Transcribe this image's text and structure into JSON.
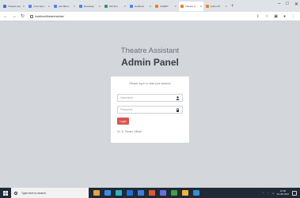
{
  "browser": {
    "tabs": [
      {
        "label": "Theatre Ass",
        "favicon_color": "#3b6fd6",
        "active": false
      },
      {
        "label": "(YouTube) -",
        "favicon_color": "#4a86e8",
        "active": false
      },
      {
        "label": "Ask Blind -",
        "favicon_color": "#4a86e8",
        "active": false
      },
      {
        "label": "Bootstrap",
        "favicon_color": "#4a86e8",
        "active": false
      },
      {
        "label": "W3 Sch",
        "favicon_color": "#2e9b4f",
        "active": false
      },
      {
        "label": "localhost",
        "favicon_color": "#4a86e8",
        "active": false
      },
      {
        "label": "XAMPP",
        "favicon_color": "#f07d20",
        "active": false
      },
      {
        "label": "Theatre A",
        "favicon_color": "#f07d20",
        "active": true
      },
      {
        "label": "Admin Pl",
        "favicon_color": "#f07d20",
        "active": false
      }
    ],
    "new_tab": "+",
    "window_controls": {
      "minimize": "–",
      "maximize": "□",
      "close": "✕"
    },
    "address": "localhost/theatre/admin/"
  },
  "page": {
    "heading": "Theatre Assistant",
    "subheading": "Admin Panel",
    "card": {
      "message": "Please log in to start your session",
      "username_placeholder": "Username",
      "password_placeholder": "Password",
      "login_label": "Login",
      "back_link": "Go To Theatre Official"
    }
  },
  "taskbar": {
    "search_placeholder": "Type here to search",
    "time": "12:00",
    "date": "04-08-2022",
    "icon_colors": [
      "#e8a33d",
      "#3b8ce6",
      "#2bb3c0",
      "#1e6fd9",
      "#3d7fd6",
      "#e05a2a",
      "#6a6fd8",
      "#3ea04a",
      "#f0b43c",
      "#2d8fd6"
    ]
  },
  "colors": {
    "page_bg": "#d3d6db",
    "login_button": "#d9534f",
    "taskbar_bg": "#1f2a36"
  }
}
